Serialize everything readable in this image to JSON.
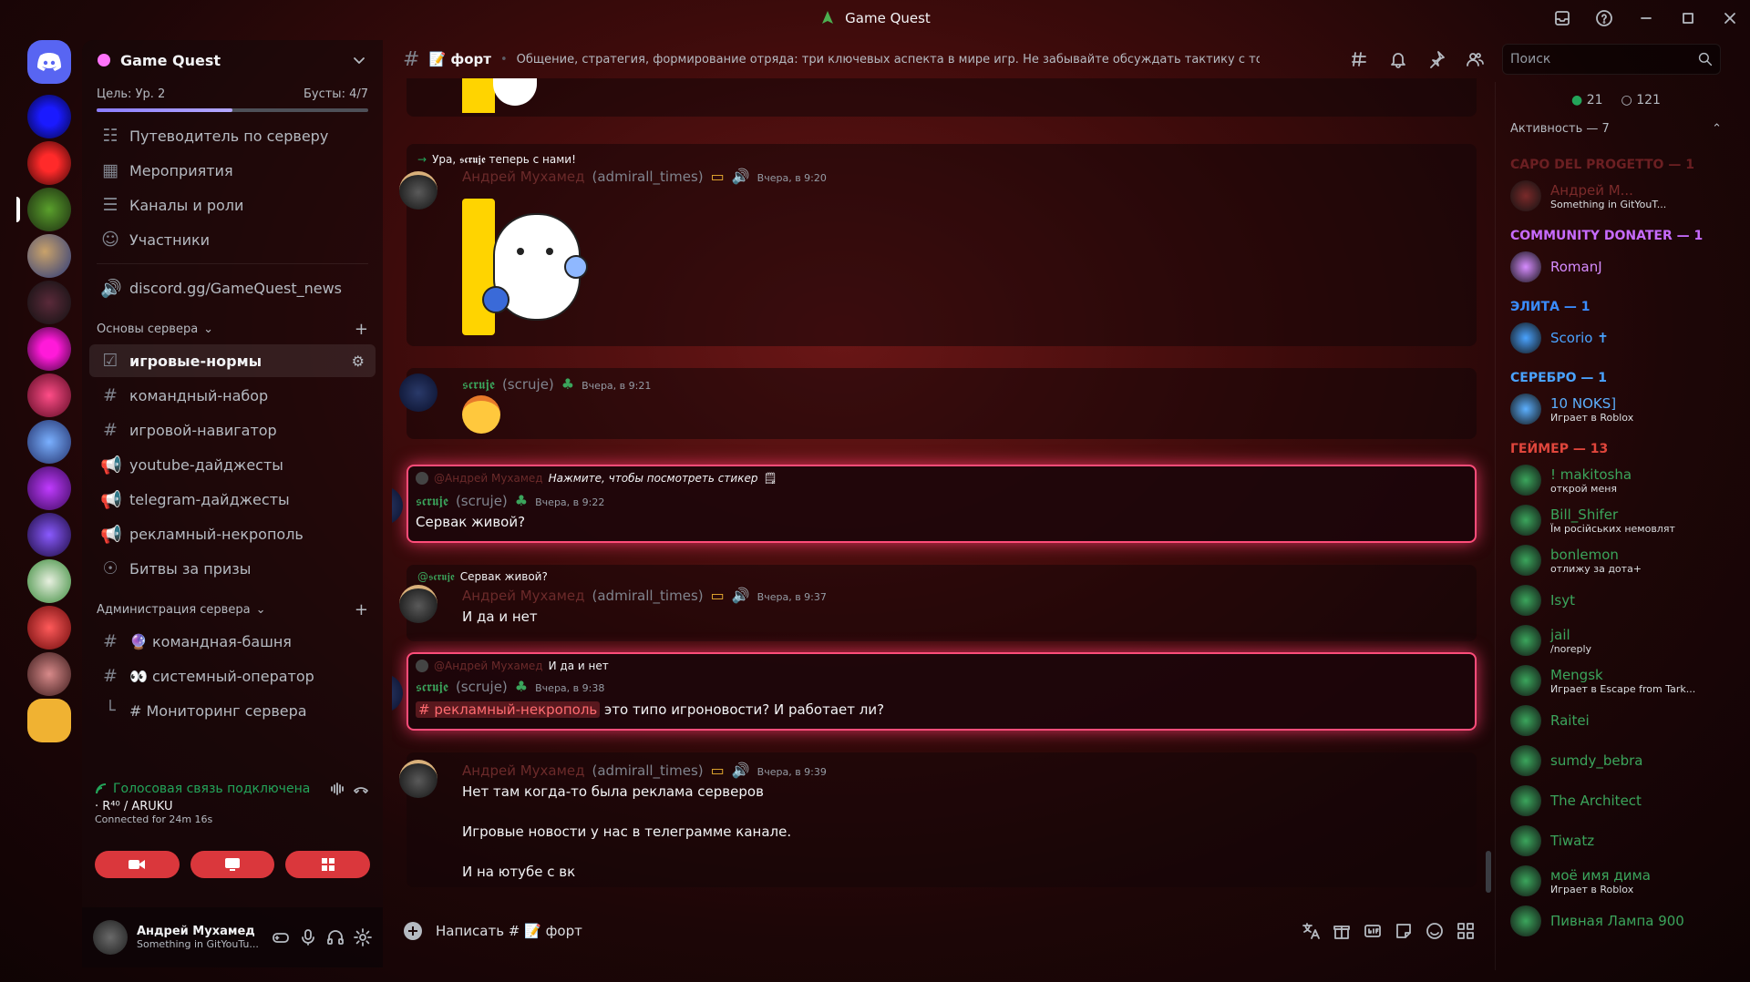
{
  "window": {
    "title": "Game Quest"
  },
  "server": {
    "name": "Game Quest",
    "goal": "Цель: Ур. 2",
    "boosts": "Бусты: 4/7",
    "progress": 0.5,
    "nav": [
      {
        "icon": "signpost-icon",
        "label": "Путеводитель по серверу"
      },
      {
        "icon": "calendar-icon",
        "label": "Мероприятия"
      },
      {
        "icon": "channels-icon",
        "label": "Каналы и роли"
      },
      {
        "icon": "members-icon",
        "label": "Участники"
      }
    ],
    "link": "discord.gg/GameQuest_news",
    "categories": [
      {
        "name": "Основы сервера",
        "channels": [
          {
            "glyph": "☑",
            "name": "игровые-нормы",
            "selected": true
          },
          {
            "glyph": "#",
            "name": "командный-набор"
          },
          {
            "glyph": "#",
            "name": "игровой-навигатор"
          },
          {
            "glyph": "📢",
            "name": "youtube-дайджесты"
          },
          {
            "glyph": "📢",
            "name": "telegram-дайджесты"
          },
          {
            "glyph": "📢",
            "name": "рекламный-некрополь"
          },
          {
            "glyph": "☉",
            "name": "Битвы за призы"
          }
        ]
      },
      {
        "name": "Администрация сервера",
        "channels": [
          {
            "glyph": "#",
            "name": "🔮 командная-башня"
          },
          {
            "glyph": "#",
            "name": "👀 системный-оператор"
          },
          {
            "glyph": "└",
            "name": "# Мониторинг сервера"
          }
        ]
      }
    ]
  },
  "voice": {
    "status": "Голосовая связь подключена",
    "channel": "· R⁴⁰ / ARUKU",
    "duration": "Connected for 24m 16s"
  },
  "me": {
    "name": "Андрей Мухамед",
    "status": "Something in GitYouTu..."
  },
  "channel": {
    "name": "📝 форт",
    "topic": "Общение, стратегия, формирование отряда: три ключевых аспекта в мире игр. Не забывайте обсуждать тактику с товарищами."
  },
  "search_placeholder": "Поиск",
  "messages": {
    "m1": {
      "system": "Ура, 𝖘𝖈𝖗𝖚𝖏𝖊 теперь с нами!",
      "name": "Андрей Мухамед",
      "user": "(admirall_times)",
      "time": "Вчера, в 9:20"
    },
    "m2": {
      "name": "𝖘𝖈𝖗𝖚𝖏𝖊",
      "user": "(scruje)",
      "time": "Вчера, в 9:21"
    },
    "m3": {
      "reply_name": "@Андрей Мухамед",
      "reply_text": "Нажмите, чтобы посмотреть стикер",
      "name": "𝖘𝖈𝖗𝖚𝖏𝖊",
      "user": "(scruje)",
      "time": "Вчера, в 9:22",
      "text": "Сервак живой?"
    },
    "m4": {
      "reply_name": "@𝖘𝖈𝖗𝖚𝖏𝖊",
      "reply_text": "Сервак живой?",
      "name": "Андрей Мухамед",
      "user": "(admirall_times)",
      "time": "Вчера, в 9:37",
      "text": "И да и нет"
    },
    "m5": {
      "reply_name": "@Андрей Мухамед",
      "reply_text": "И да и нет",
      "name": "𝖘𝖈𝖗𝖚𝖏𝖊",
      "user": "(scruje)",
      "time": "Вчера, в 9:38",
      "mention": "# рекламный-некрополь",
      "text": " это типо игроновости? И работает ли?"
    },
    "m6": {
      "name": "Андрей Мухамед",
      "user": "(admirall_times)",
      "time": "Вчера, в 9:39",
      "lines": [
        "Нет там когда-то была реклама серверов",
        "Игровые новости у нас в телеграмме канале.",
        "И на ютубе с вк"
      ]
    }
  },
  "composer_placeholder": "Написать # 📝 форт",
  "online": "21",
  "total": "121",
  "activity": "Активность — 7",
  "members": [
    {
      "group": "CAPO DEL PROGETTO — 1",
      "gcolor": "#6b1f22",
      "users": [
        {
          "name": "Андрей М...",
          "color": "#7a2a2a",
          "status": "Something in GitYouT..."
        }
      ]
    },
    {
      "group": "COMMUNITY DONATER — 1",
      "gcolor": "#c76bff",
      "users": [
        {
          "name": "RomanJ",
          "color": "#d68cff"
        }
      ]
    },
    {
      "group": "ЭЛИТА — 1",
      "gcolor": "#3a8dff",
      "users": [
        {
          "name": "Scorio ✝",
          "color": "#4aa3ff"
        }
      ]
    },
    {
      "group": "СЕРЕБРО — 1",
      "gcolor": "#4aa3ff",
      "users": [
        {
          "name": "10 NOKS]",
          "color": "#5cb0ff",
          "status": "Играет в Roblox"
        }
      ]
    },
    {
      "group": "ГЕЙМЕР — 13",
      "gcolor": "#e0463c",
      "users": [
        {
          "name": "! makitosha",
          "color": "#3ba55c",
          "status": "открой меня"
        },
        {
          "name": "Bill_Shifer",
          "color": "#3ba55c",
          "status": "Їм російських немовлят"
        },
        {
          "name": "bonlemon",
          "color": "#3ba55c",
          "status": "отлижу за дота+"
        },
        {
          "name": "Isyt",
          "color": "#3ba55c"
        },
        {
          "name": "jail",
          "color": "#3ba55c",
          "status": "/noreply"
        },
        {
          "name": "Mengsk",
          "color": "#3ba55c",
          "status": "Играет в Escape from Tark..."
        },
        {
          "name": "Raitei",
          "color": "#3ba55c"
        },
        {
          "name": "sumdy_bebra",
          "color": "#3ba55c"
        },
        {
          "name": "The Architect",
          "color": "#3ba55c"
        },
        {
          "name": "Tiwatz",
          "color": "#3ba55c"
        },
        {
          "name": "моё имя дима",
          "color": "#3ba55c",
          "status": "Играет в Roblox"
        },
        {
          "name": "Пивная Лампа 900",
          "color": "#3ba55c"
        }
      ]
    }
  ]
}
